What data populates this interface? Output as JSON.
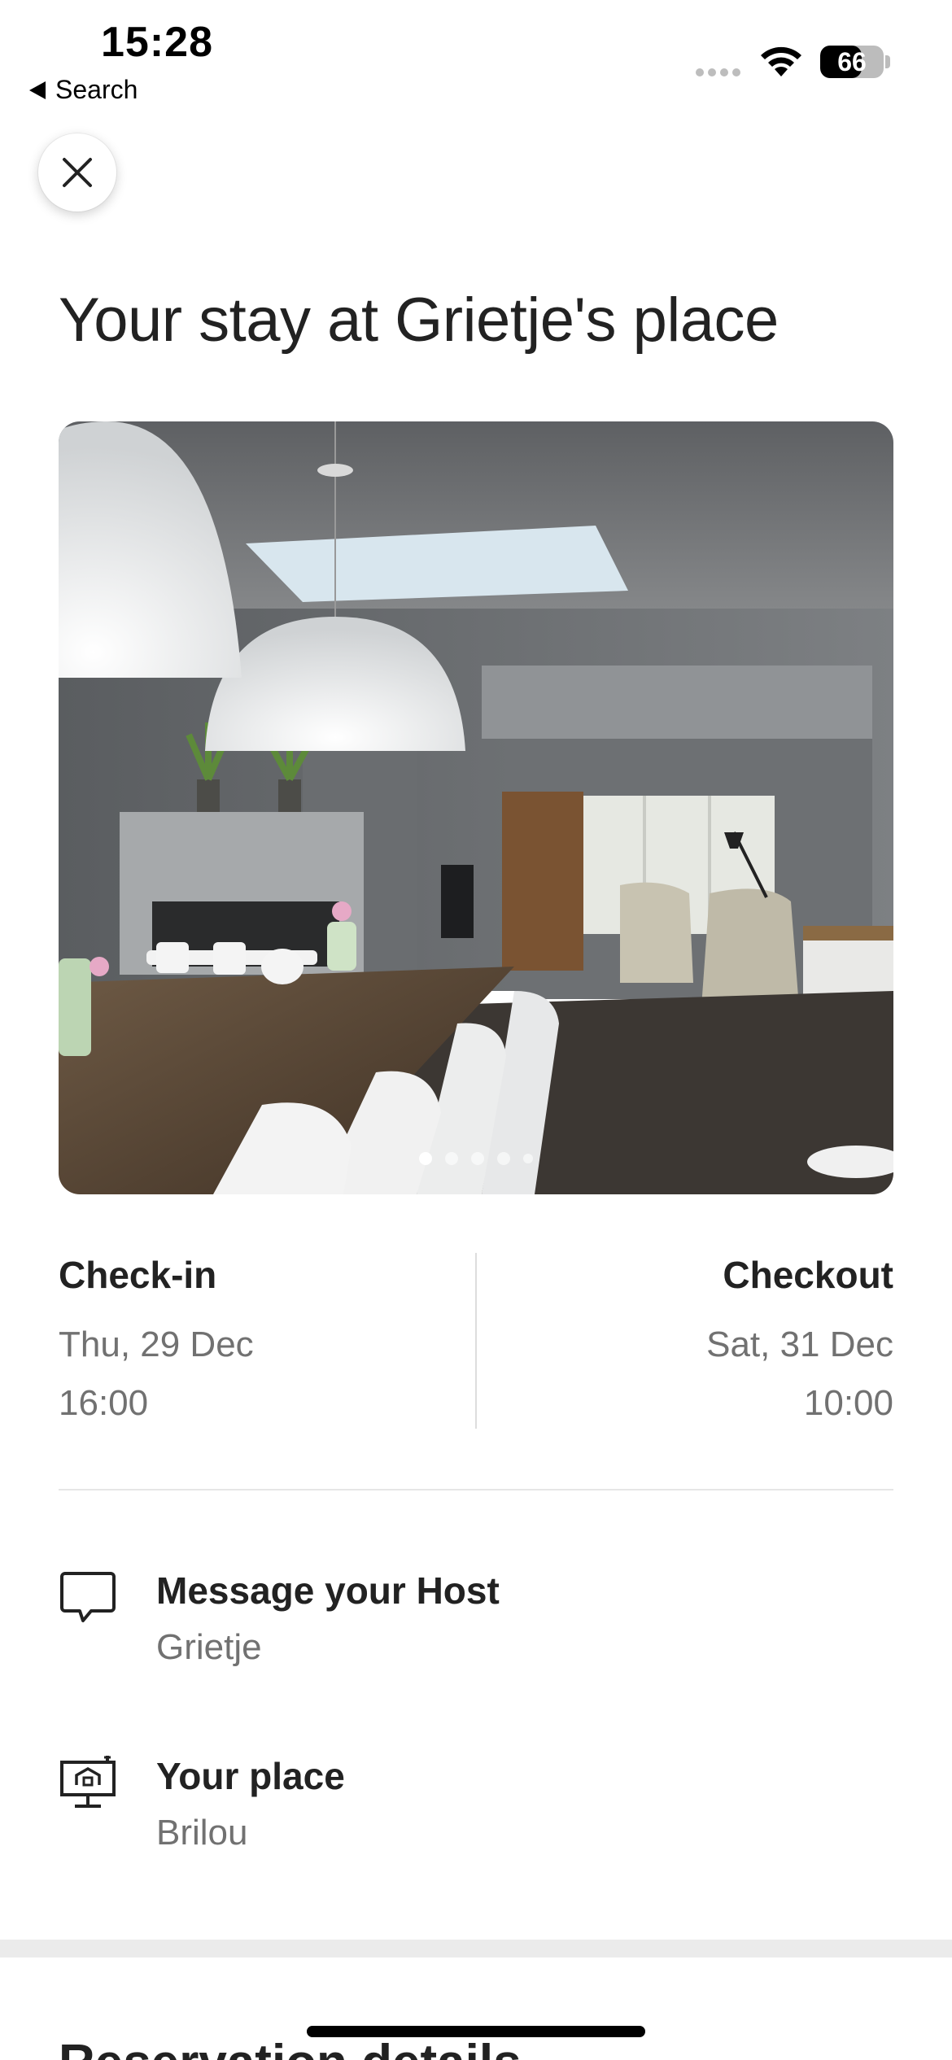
{
  "status_bar": {
    "time": "15:28",
    "back_label": "Search",
    "battery_percent": "66",
    "battery_level": 0.66
  },
  "header": {
    "close_icon": "close-icon"
  },
  "title": "Your stay at Grietje's place",
  "photo": {
    "pages": 5,
    "current_page": 1
  },
  "checkin": {
    "label": "Check-in",
    "date": "Thu, 29 Dec",
    "time": "16:00"
  },
  "checkout": {
    "label": "Checkout",
    "date": "Sat, 31 Dec",
    "time": "10:00"
  },
  "rows": [
    {
      "icon": "message-bubble-icon",
      "title": "Message your Host",
      "subtitle": "Grietje"
    },
    {
      "icon": "home-screen-icon",
      "title": "Your place",
      "subtitle": "Brilou"
    }
  ],
  "next_section": {
    "heading": "Reservation details"
  },
  "colors": {
    "text_primary": "#222222",
    "text_secondary": "#717171",
    "divider": "#dddddd"
  }
}
